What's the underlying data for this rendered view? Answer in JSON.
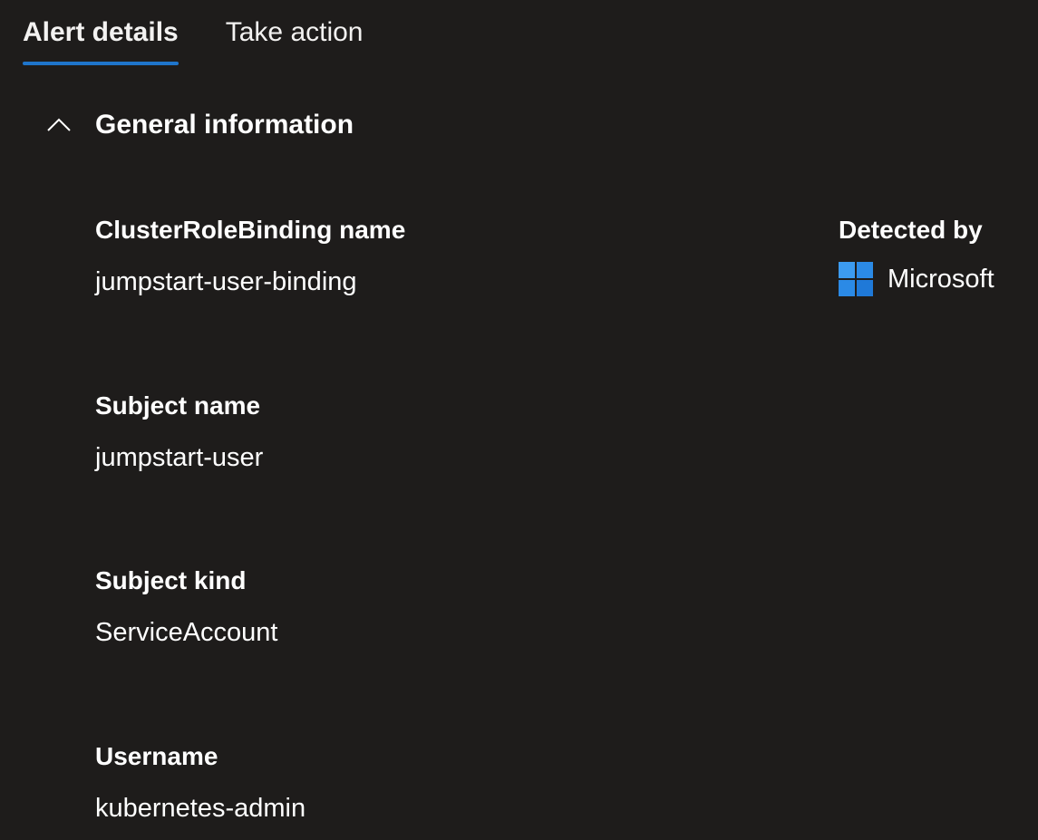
{
  "tabs": [
    {
      "label": "Alert details",
      "active": true
    },
    {
      "label": "Take action",
      "active": false
    }
  ],
  "section": {
    "title": "General information",
    "expanded": true,
    "toggle_icon": "chevron-up-icon"
  },
  "fields": {
    "clusterrolebinding": {
      "label": "ClusterRoleBinding name",
      "value": "jumpstart-user-binding"
    },
    "detected_by": {
      "label": "Detected by",
      "value": "Microsoft",
      "icon": "windows-logo-icon",
      "icon_color": "#2b8ae6"
    },
    "subject_name": {
      "label": "Subject name",
      "value": "jumpstart-user"
    },
    "subject_kind": {
      "label": "Subject kind",
      "value": "ServiceAccount"
    },
    "username": {
      "label": "Username",
      "value": "kubernetes-admin"
    }
  },
  "colors": {
    "background": "#1e1c1b",
    "text": "#ffffff",
    "accent": "#1f75cb"
  }
}
